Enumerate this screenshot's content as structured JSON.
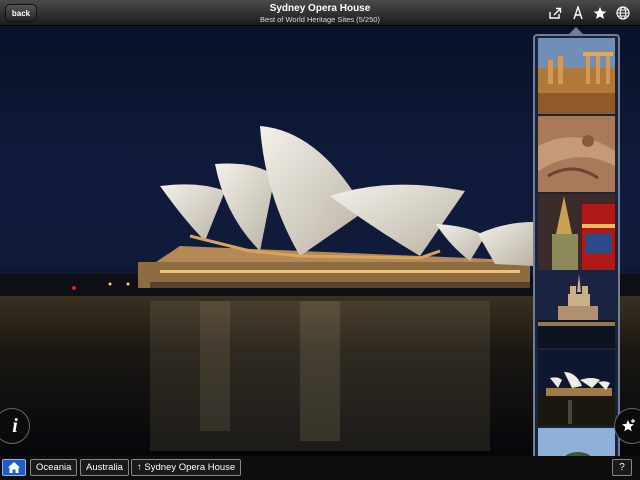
{
  "header": {
    "back_label": "back",
    "title": "Sydney Opera House",
    "subtitle": "Best of World Heritage Sites (5/250)",
    "icons": [
      "share-icon",
      "text-size-icon",
      "star-icon",
      "globe-icon"
    ]
  },
  "thumbnails": [
    {
      "name": "thumb-ruins",
      "desc": "ancient ruins"
    },
    {
      "name": "thumb-rock-art",
      "desc": "rock art"
    },
    {
      "name": "thumb-temple",
      "desc": "temple"
    },
    {
      "name": "thumb-cathedral",
      "desc": "cathedral at night"
    },
    {
      "name": "thumb-opera-house",
      "desc": "opera house at night"
    },
    {
      "name": "thumb-landscape",
      "desc": "landscape"
    }
  ],
  "info_button": {
    "label": "i"
  },
  "breadcrumb": {
    "home_icon": "home-icon",
    "items": [
      "Oceania",
      "Australia",
      "↑ Sydney Opera House"
    ]
  },
  "help_label": "?",
  "colors": {
    "accent": "#1f5cc5",
    "strip_border": "#6d7f9a",
    "night_sky": "#0f1a3a"
  }
}
